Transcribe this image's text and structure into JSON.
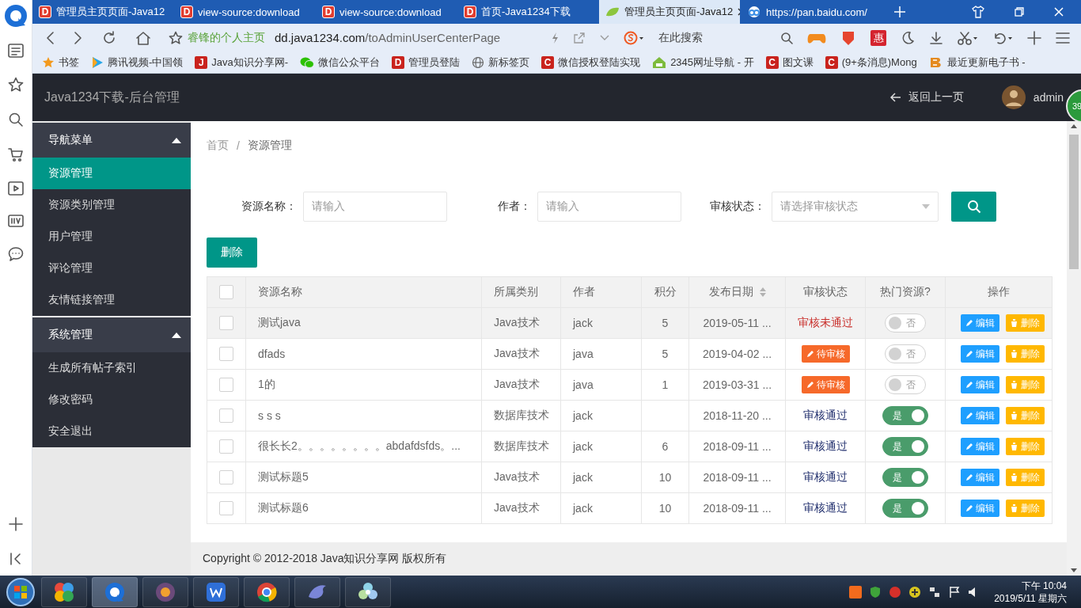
{
  "browser": {
    "tabs": [
      {
        "title": "管理员主页页面-Java12",
        "kind": "letter",
        "icon_text": "D",
        "selected": false
      },
      {
        "title": "view-source:download",
        "kind": "letter",
        "icon_text": "D",
        "selected": false
      },
      {
        "title": "view-source:download",
        "kind": "letter",
        "icon_text": "D",
        "selected": false
      },
      {
        "title": "首页-Java1234下载",
        "kind": "letter",
        "icon_text": "D",
        "selected": false
      },
      {
        "title": "管理员主页页面-Java12",
        "kind": "leaf",
        "selected": true
      },
      {
        "title": "https://pan.baidu.com/",
        "kind": "cloud",
        "selected": false
      }
    ],
    "address_bar": {
      "site_label": "睿锋的个人主页",
      "url_host": "dd.java1234.com",
      "url_path": "/toAdminUserCenterPage",
      "search_placeholder": "在此搜索",
      "coupon_text": "惠"
    },
    "bookmarks": [
      {
        "label": "书签",
        "kind": "star"
      },
      {
        "label": "腾讯视频-中国领",
        "kind": "video"
      },
      {
        "label": "Java知识分享网-",
        "kind": "letter",
        "icon_text": "J"
      },
      {
        "label": "微信公众平台",
        "kind": "wechat"
      },
      {
        "label": "管理员登陆",
        "kind": "letter",
        "icon_text": "D"
      },
      {
        "label": "新标签页",
        "kind": "globe"
      },
      {
        "label": "微信授权登陆实现",
        "kind": "letter",
        "icon_text": "C"
      },
      {
        "label": "2345网址导航 - 开",
        "kind": "house"
      },
      {
        "label": "图文课",
        "kind": "letter",
        "icon_text": "C"
      },
      {
        "label": "(9+条消息)Mong",
        "kind": "letter",
        "icon_text": "C"
      },
      {
        "label": "最近更新电子书 -",
        "kind": "book"
      }
    ]
  },
  "app": {
    "brand": "Java1234下载-后台管理",
    "back_link": "返回上一页",
    "user": "admin",
    "side_badge": "39",
    "menu": [
      {
        "label": "导航菜单",
        "expanded": true,
        "children": [
          {
            "label": "资源管理",
            "selected": true
          },
          {
            "label": "资源类别管理",
            "selected": false
          },
          {
            "label": "用户管理",
            "selected": false
          },
          {
            "label": "评论管理",
            "selected": false
          },
          {
            "label": "友情链接管理",
            "selected": false
          }
        ]
      },
      {
        "label": "系统管理",
        "expanded": true,
        "children": [
          {
            "label": "生成所有帖子索引",
            "selected": false
          },
          {
            "label": "修改密码",
            "selected": false
          },
          {
            "label": "安全退出",
            "selected": false
          }
        ]
      }
    ],
    "breadcrumb": [
      "首页",
      "资源管理"
    ],
    "breadcrumb_separator": "/",
    "filters": [
      {
        "label": "资源名称：",
        "placeholder": "请输入",
        "kind": "text"
      },
      {
        "label": "作者：",
        "placeholder": "请输入",
        "kind": "text"
      },
      {
        "label": "审核状态：",
        "placeholder": "请选择审核状态",
        "kind": "select"
      }
    ],
    "delete_button": "删除",
    "table": {
      "select_all_checked": false,
      "columns": [
        {
          "label": "资源名称",
          "sortable": false
        },
        {
          "label": "所属类别",
          "sortable": false
        },
        {
          "label": "作者",
          "sortable": false
        },
        {
          "label": "积分",
          "sortable": false
        },
        {
          "label": "发布日期",
          "sortable": true
        },
        {
          "label": "审核状态",
          "sortable": false
        },
        {
          "label": "热门资源?",
          "sortable": false
        },
        {
          "label": "操作",
          "sortable": false
        }
      ],
      "rows": [
        {
          "checked": false,
          "hovered": true,
          "name": "测试java",
          "category": "Java技术",
          "author": "jack",
          "points": "5",
          "date": "2019-05-11 ...",
          "status": {
            "kind": "rejected",
            "text": "审核未通过"
          },
          "hot": {
            "on": false,
            "text": "否"
          },
          "actions": [
            "编辑",
            "删除"
          ]
        },
        {
          "checked": false,
          "hovered": false,
          "name": "dfads",
          "category": "Java技术",
          "author": "java",
          "points": "5",
          "date": "2019-04-02 ...",
          "status": {
            "kind": "pending",
            "text": "待审核"
          },
          "hot": {
            "on": false,
            "text": "否"
          },
          "actions": [
            "编辑",
            "删除"
          ]
        },
        {
          "checked": false,
          "hovered": false,
          "name": "1的",
          "category": "Java技术",
          "author": "java",
          "points": "1",
          "date": "2019-03-31 ...",
          "status": {
            "kind": "pending",
            "text": "待审核"
          },
          "hot": {
            "on": false,
            "text": "否"
          },
          "actions": [
            "编辑",
            "删除"
          ]
        },
        {
          "checked": false,
          "hovered": false,
          "name": "s s s",
          "category": "数据库技术",
          "author": "jack",
          "date": "2018-11-20 ...",
          "status": {
            "kind": "approved",
            "text": "审核通过"
          },
          "hot": {
            "on": true,
            "text": "是"
          },
          "actions": [
            "编辑",
            "删除"
          ]
        },
        {
          "checked": false,
          "hovered": false,
          "name": "很长长2。。。。。。。。abdafdsfds。...",
          "category": "数据库技术",
          "author": "jack",
          "points": "6",
          "date": "2018-09-11 ...",
          "status": {
            "kind": "approved",
            "text": "审核通过"
          },
          "hot": {
            "on": true,
            "text": "是"
          },
          "actions": [
            "编辑",
            "删除"
          ]
        },
        {
          "checked": false,
          "hovered": false,
          "name": "测试标题5",
          "category": "Java技术",
          "author": "jack",
          "points": "10",
          "date": "2018-09-11 ...",
          "status": {
            "kind": "approved",
            "text": "审核通过"
          },
          "hot": {
            "on": true,
            "text": "是"
          },
          "actions": [
            "编辑",
            "删除"
          ]
        },
        {
          "checked": false,
          "hovered": false,
          "name": "测试标题6",
          "category": "Java技术",
          "author": "jack",
          "points": "10",
          "date": "2018-09-11 ...",
          "status": {
            "kind": "approved",
            "text": "审核通过"
          },
          "hot": {
            "on": true,
            "text": "是"
          },
          "actions": [
            "编辑",
            "删除"
          ]
        }
      ]
    },
    "footer": "Copyright © 2012-2018 Java知识分享网 版权所有"
  },
  "taskbar": {
    "time": "下午 10:04",
    "date": "2019/5/11 星期六"
  }
}
